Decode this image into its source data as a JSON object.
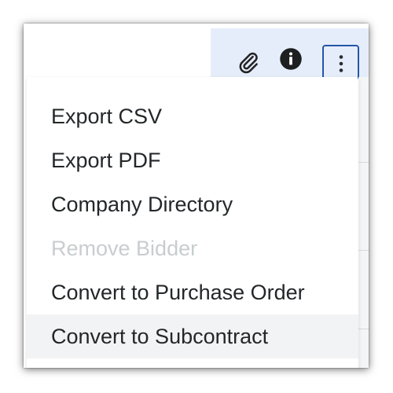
{
  "toolbar": {
    "background": "#e6edfa",
    "buttons": [
      {
        "icon": "paperclip-icon",
        "label": "Attachments"
      },
      {
        "icon": "info-icon",
        "label": "Information"
      },
      {
        "icon": "vertical-ellipsis-icon",
        "label": "More actions",
        "state": "focused"
      }
    ]
  },
  "menu": {
    "items": [
      {
        "label": "Export CSV",
        "enabled": true
      },
      {
        "label": "Export PDF",
        "enabled": true
      },
      {
        "label": "Company Directory",
        "enabled": true
      },
      {
        "label": "Remove Bidder",
        "enabled": false
      },
      {
        "label": "Convert to Purchase Order",
        "enabled": true
      },
      {
        "label": "Convert to Subcontract",
        "enabled": true,
        "hovered": true
      }
    ]
  },
  "colors": {
    "focus_ring": "#2456a6",
    "text": "#232729",
    "disabled_text": "#c8cdcf",
    "hover_bg": "#f2f3f5"
  }
}
